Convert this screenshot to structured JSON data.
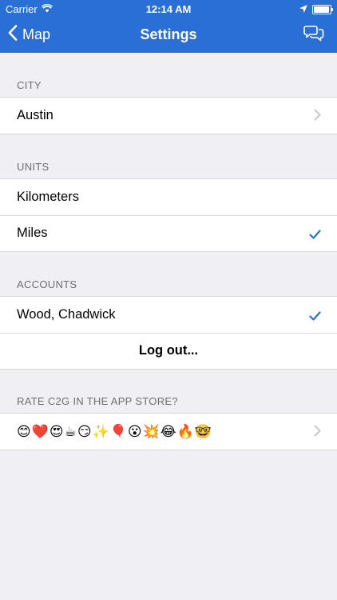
{
  "status_bar": {
    "carrier": "Carrier",
    "time": "12:14 AM"
  },
  "nav": {
    "back_label": "Map",
    "title": "Settings"
  },
  "city": {
    "header": "CITY",
    "value": "Austin"
  },
  "units": {
    "header": "UNITS",
    "options": [
      {
        "label": "Kilometers",
        "selected": false
      },
      {
        "label": "Miles",
        "selected": true
      }
    ]
  },
  "accounts": {
    "header": "ACCOUNTS",
    "account_name": "Wood, Chadwick",
    "logout_label": "Log out..."
  },
  "rate": {
    "header": "RATE C2G IN THE APP STORE?",
    "emojis": "😊❤️😍☕😏✨🎈😮💥😂🔥🤓"
  },
  "colors": {
    "accent": "#2a6fd6",
    "check": "#2a6fd6",
    "background": "#efeff4"
  }
}
